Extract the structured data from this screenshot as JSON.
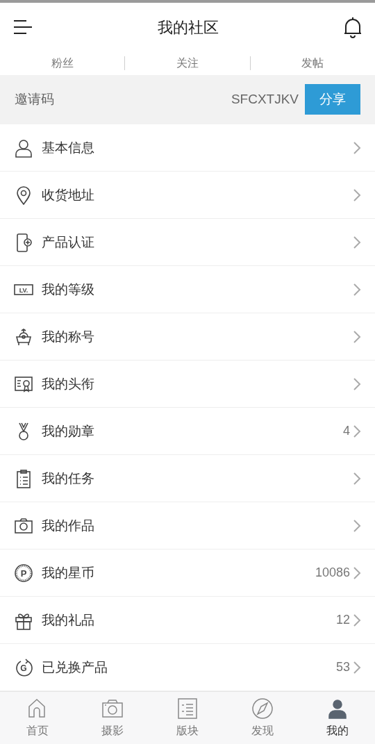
{
  "header": {
    "title": "我的社区"
  },
  "stats_tabs": [
    "粉丝",
    "关注",
    "发帖"
  ],
  "invite": {
    "label": "邀请码",
    "code": "SFCXTJKV",
    "button": "分享"
  },
  "menu": [
    {
      "label": "基本信息"
    },
    {
      "label": "收货地址"
    },
    {
      "label": "产品认证"
    },
    {
      "label": "我的等级",
      "icon_text": "LV."
    },
    {
      "label": "我的称号"
    },
    {
      "label": "我的头衔"
    },
    {
      "label": "我的勋章",
      "count": "4"
    },
    {
      "label": "我的任务"
    },
    {
      "label": "我的作品"
    },
    {
      "label": "我的星币",
      "icon_text": "P",
      "count": "10086"
    },
    {
      "label": "我的礼品",
      "count": "12"
    },
    {
      "label": "已兑换产品",
      "icon_text": "G",
      "count": "53"
    }
  ],
  "bottom_nav": [
    {
      "label": "首页",
      "selected": false
    },
    {
      "label": "摄影",
      "selected": false
    },
    {
      "label": "版块",
      "selected": false
    },
    {
      "label": "发现",
      "selected": false
    },
    {
      "label": "我的",
      "selected": true
    }
  ]
}
